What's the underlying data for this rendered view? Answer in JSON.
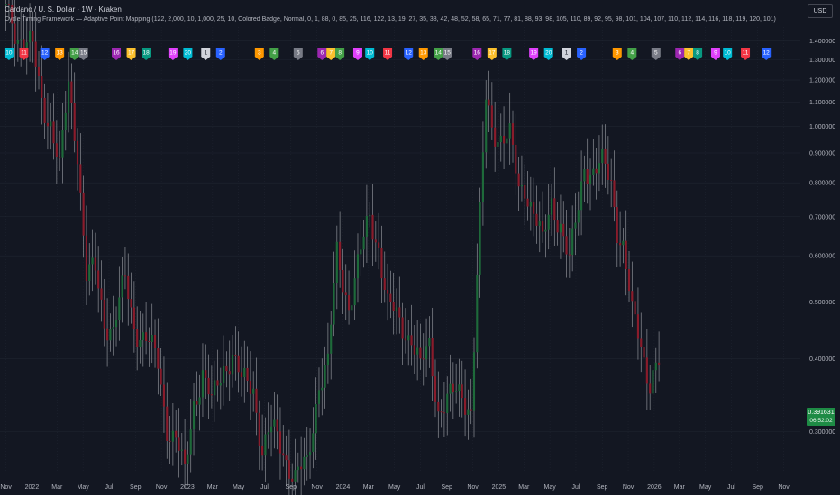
{
  "header": {
    "symbol_line": "Cardano / U. S. Dollar · 1W · Kraken",
    "indicator_line": "Cycle Timing Framework — Adaptive Point Mapping (122, 2,000, 10, 1,000, 25, 10, Colored Badge, Normal, 0, 1, 88, 0, 85, 25, 116, 122, 13, 19, 27, 35, 38, 42, 48, 52, 58, 65, 71, 77, 81, 88, 93, 98, 105, 110, 89, 92, 95, 98, 101, 104, 107, 110, 112, 114, 116, 118, 119, 120, 101)",
    "currency": "USD"
  },
  "last_price": {
    "value": "0.391631",
    "countdown": "06:52:02",
    "color": "#1e8b45"
  },
  "colors": {
    "background": "#131722",
    "grid": "#1f2430",
    "up": "#1e6a3a",
    "down": "#8a1c2b",
    "wick": "#8c8f96",
    "axis_text": "#b2b5be"
  },
  "chart_data": {
    "type": "candlestick",
    "title": "Cardano / U. S. Dollar · 1W · Kraken",
    "xlabel": "",
    "ylabel": "",
    "y_scale": "log",
    "ylim": [
      0.255,
      1.48
    ],
    "y_ticks": [
      "1.400000",
      "1.300000",
      "1.200000",
      "1.100000",
      "1.000000",
      "0.900000",
      "0.800000",
      "0.700000",
      "0.600000",
      "0.500000",
      "0.400000",
      "0.300000"
    ],
    "x_ticks": [
      {
        "label": "Nov",
        "date": "2021-11-01"
      },
      {
        "label": "2022",
        "date": "2022-01-01"
      },
      {
        "label": "Mar",
        "date": "2022-03-01"
      },
      {
        "label": "May",
        "date": "2022-05-01"
      },
      {
        "label": "Jul",
        "date": "2022-07-01"
      },
      {
        "label": "Sep",
        "date": "2022-09-01"
      },
      {
        "label": "Nov",
        "date": "2022-11-01"
      },
      {
        "label": "2023",
        "date": "2023-01-01"
      },
      {
        "label": "Mar",
        "date": "2023-03-01"
      },
      {
        "label": "May",
        "date": "2023-05-01"
      },
      {
        "label": "Jul",
        "date": "2023-07-01"
      },
      {
        "label": "Sep",
        "date": "2023-09-01"
      },
      {
        "label": "Nov",
        "date": "2023-11-01"
      },
      {
        "label": "2024",
        "date": "2024-01-01"
      },
      {
        "label": "Mar",
        "date": "2024-03-01"
      },
      {
        "label": "May",
        "date": "2024-05-01"
      },
      {
        "label": "Jul",
        "date": "2024-07-01"
      },
      {
        "label": "Sep",
        "date": "2024-09-01"
      },
      {
        "label": "Nov",
        "date": "2024-11-01"
      },
      {
        "label": "2025",
        "date": "2025-01-01"
      },
      {
        "label": "Mar",
        "date": "2025-03-01"
      },
      {
        "label": "May",
        "date": "2025-05-01"
      },
      {
        "label": "Jul",
        "date": "2025-07-01"
      },
      {
        "label": "Sep",
        "date": "2025-09-01"
      },
      {
        "label": "Nov",
        "date": "2025-11-01"
      },
      {
        "label": "2026",
        "date": "2026-01-01"
      },
      {
        "label": "Mar",
        "date": "2026-03-01"
      },
      {
        "label": "May",
        "date": "2026-05-01"
      },
      {
        "label": "Jul",
        "date": "2026-07-01"
      },
      {
        "label": "Sep",
        "date": "2026-09-01"
      },
      {
        "label": "Nov",
        "date": "2026-11-01"
      }
    ],
    "price_path": [
      [
        "2021-11-01",
        1.6
      ],
      [
        "2021-12-06",
        1.42
      ],
      [
        "2022-01-03",
        1.34
      ],
      [
        "2022-01-24",
        1.12
      ],
      [
        "2022-02-14",
        1.02
      ],
      [
        "2022-03-07",
        0.83
      ],
      [
        "2022-03-28",
        1.18
      ],
      [
        "2022-04-18",
        0.92
      ],
      [
        "2022-05-09",
        0.55
      ],
      [
        "2022-05-30",
        0.56
      ],
      [
        "2022-06-20",
        0.47
      ],
      [
        "2022-07-11",
        0.45
      ],
      [
        "2022-08-08",
        0.54
      ],
      [
        "2022-08-29",
        0.46
      ],
      [
        "2022-09-26",
        0.43
      ],
      [
        "2022-10-24",
        0.39
      ],
      [
        "2022-11-14",
        0.31
      ],
      [
        "2022-12-05",
        0.29
      ],
      [
        "2022-12-26",
        0.25
      ],
      [
        "2023-01-16",
        0.34
      ],
      [
        "2023-02-06",
        0.38
      ],
      [
        "2023-02-27",
        0.33
      ],
      [
        "2023-03-27",
        0.39
      ],
      [
        "2023-04-17",
        0.41
      ],
      [
        "2023-05-08",
        0.36
      ],
      [
        "2023-06-05",
        0.36
      ],
      [
        "2023-06-26",
        0.28
      ],
      [
        "2023-07-17",
        0.3
      ],
      [
        "2023-08-14",
        0.28
      ],
      [
        "2023-09-11",
        0.25
      ],
      [
        "2023-10-09",
        0.26
      ],
      [
        "2023-11-06",
        0.37
      ],
      [
        "2023-11-27",
        0.39
      ],
      [
        "2023-12-18",
        0.6
      ],
      [
        "2024-01-15",
        0.5
      ],
      [
        "2024-02-12",
        0.6
      ],
      [
        "2024-03-04",
        0.7
      ],
      [
        "2024-03-25",
        0.63
      ],
      [
        "2024-04-15",
        0.49
      ],
      [
        "2024-05-13",
        0.46
      ],
      [
        "2024-06-10",
        0.44
      ],
      [
        "2024-07-01",
        0.38
      ],
      [
        "2024-07-22",
        0.42
      ],
      [
        "2024-08-12",
        0.33
      ],
      [
        "2024-09-09",
        0.34
      ],
      [
        "2024-10-07",
        0.35
      ],
      [
        "2024-10-28",
        0.33
      ],
      [
        "2024-11-11",
        0.55
      ],
      [
        "2024-12-02",
        1.1
      ],
      [
        "2024-12-16",
        1.0
      ],
      [
        "2025-01-06",
        0.97
      ],
      [
        "2025-01-27",
        0.95
      ],
      [
        "2025-02-17",
        0.77
      ],
      [
        "2025-03-03",
        0.8
      ],
      [
        "2025-03-24",
        0.72
      ],
      [
        "2025-04-14",
        0.62
      ],
      [
        "2025-05-05",
        0.74
      ],
      [
        "2025-05-26",
        0.69
      ],
      [
        "2025-06-16",
        0.58
      ],
      [
        "2025-07-07",
        0.72
      ],
      [
        "2025-07-21",
        0.87
      ],
      [
        "2025-08-11",
        0.84
      ],
      [
        "2025-09-01",
        0.85
      ],
      [
        "2025-09-22",
        0.8
      ],
      [
        "2025-10-06",
        0.68
      ],
      [
        "2025-10-20",
        0.63
      ],
      [
        "2025-11-10",
        0.47
      ],
      [
        "2025-12-01",
        0.42
      ],
      [
        "2025-12-22",
        0.37
      ],
      [
        "2026-01-05",
        0.39
      ]
    ],
    "last_bar": "2026-01-12",
    "markers": {
      "first_row": [
        {
          "label": "10",
          "color": "#00bcd4",
          "date": "2021-11-08"
        },
        {
          "label": "11",
          "color": "#f23645",
          "date": "2021-12-13"
        },
        {
          "label": "12",
          "color": "#2962ff",
          "date": "2022-01-31"
        },
        {
          "label": "13",
          "color": "#ff9800",
          "date": "2022-03-07"
        },
        {
          "label": "14",
          "color": "#43a047",
          "date": "2022-04-11"
        },
        {
          "label": "15",
          "color": "#787b86",
          "date": "2022-05-02"
        },
        {
          "label": "16",
          "color": "#9c27b0",
          "date": "2022-07-18"
        },
        {
          "label": "17",
          "color": "#fbc02d",
          "date": "2022-08-22"
        },
        {
          "label": "18",
          "color": "#089981",
          "date": "2022-09-26"
        },
        {
          "label": "19",
          "color": "#e040fb",
          "date": "2022-11-28"
        },
        {
          "label": "20",
          "color": "#00bcd4",
          "date": "2023-01-02"
        },
        {
          "label": "1",
          "color": "#d1d4dc",
          "date": "2023-02-13"
        },
        {
          "label": "2",
          "color": "#2962ff",
          "date": "2023-03-20"
        },
        {
          "label": "3",
          "color": "#ff9800",
          "date": "2023-06-19"
        },
        {
          "label": "4",
          "color": "#43a047",
          "date": "2023-07-24"
        },
        {
          "label": "5",
          "color": "#787b86",
          "date": "2023-09-18"
        },
        {
          "label": "6",
          "color": "#9c27b0",
          "date": "2023-11-13"
        },
        {
          "label": "7",
          "color": "#fbc02d",
          "date": "2023-12-04"
        },
        {
          "label": "8",
          "color": "#43a047",
          "date": "2023-12-25"
        },
        {
          "label": "9",
          "color": "#e040fb",
          "date": "2024-02-05"
        },
        {
          "label": "10",
          "color": "#00bcd4",
          "date": "2024-03-04"
        },
        {
          "label": "11",
          "color": "#f23645",
          "date": "2024-04-15"
        },
        {
          "label": "12",
          "color": "#2962ff",
          "date": "2024-06-03"
        },
        {
          "label": "13",
          "color": "#ff9800",
          "date": "2024-07-08"
        },
        {
          "label": "14",
          "color": "#43a047",
          "date": "2024-08-12"
        },
        {
          "label": "15",
          "color": "#787b86",
          "date": "2024-09-02"
        }
      ],
      "second_row": [
        {
          "label": "16",
          "color": "#9c27b0",
          "date": "2024-11-11"
        },
        {
          "label": "17",
          "color": "#fbc02d",
          "date": "2024-12-16"
        },
        {
          "label": "18",
          "color": "#089981",
          "date": "2025-01-20"
        },
        {
          "label": "19",
          "color": "#e040fb",
          "date": "2025-03-24"
        },
        {
          "label": "20",
          "color": "#00bcd4",
          "date": "2025-04-28"
        },
        {
          "label": "1",
          "color": "#d1d4dc",
          "date": "2025-06-09"
        },
        {
          "label": "2",
          "color": "#2962ff",
          "date": "2025-07-14"
        },
        {
          "label": "3",
          "color": "#ff9800",
          "date": "2025-10-06"
        },
        {
          "label": "4",
          "color": "#43a047",
          "date": "2025-11-10"
        },
        {
          "label": "5",
          "color": "#787b86",
          "date": "2026-01-05"
        },
        {
          "label": "6",
          "color": "#9c27b0",
          "date": "2026-03-02"
        },
        {
          "label": "7",
          "color": "#fbc02d",
          "date": "2026-03-23"
        },
        {
          "label": "8",
          "color": "#089981",
          "date": "2026-04-13"
        },
        {
          "label": "9",
          "color": "#e040fb",
          "date": "2026-05-25"
        },
        {
          "label": "10",
          "color": "#00bcd4",
          "date": "2026-06-22"
        },
        {
          "label": "11",
          "color": "#f23645",
          "date": "2026-08-03"
        },
        {
          "label": "12",
          "color": "#2962ff",
          "date": "2026-09-21"
        }
      ]
    }
  }
}
